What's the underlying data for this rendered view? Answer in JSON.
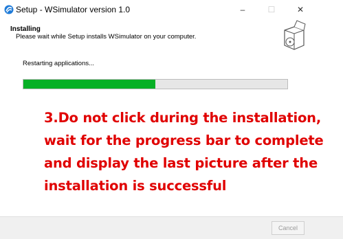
{
  "window": {
    "title": "Setup - WSimulator version 1.0",
    "icons": {
      "app": "setup-app-icon",
      "minimize": "minimize-icon",
      "maximize": "maximize-icon",
      "close": "close-icon"
    },
    "min_symbol": "–",
    "max_symbol": "☐",
    "close_symbol": "✕"
  },
  "header": {
    "title": "Installing",
    "subtitle": "Please wait while Setup installs WSimulator on your computer.",
    "icon": "install-box-icon"
  },
  "status": {
    "text": "Restarting applications..."
  },
  "progress": {
    "value_percent": 50,
    "fill_color": "#06b025"
  },
  "instruction": {
    "lines": [
      "3.Do not click during the installation,",
      "wait for the progress bar to complete",
      "and display the last picture after the",
      "installation is successful"
    ],
    "color": "#e00000"
  },
  "footer": {
    "cancel_label": "Cancel"
  }
}
